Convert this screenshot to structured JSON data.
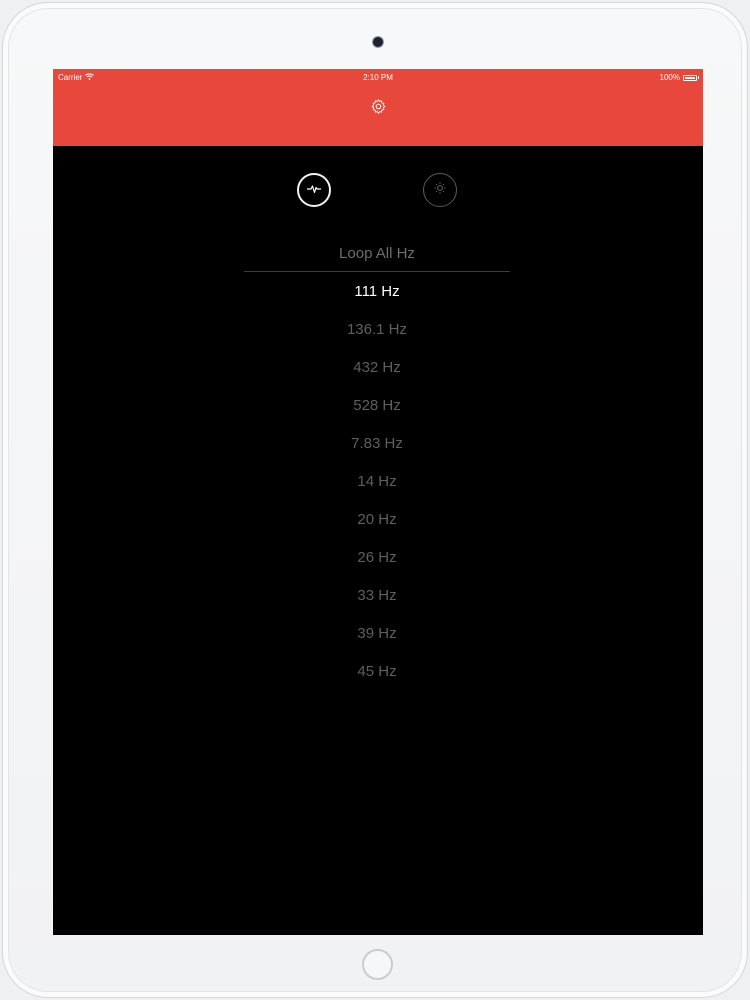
{
  "status_bar": {
    "carrier": "Carrier",
    "time": "2:10 PM",
    "battery": "100%"
  },
  "header": {
    "settings_icon": "gear-icon",
    "color": "#e8483b"
  },
  "modes": [
    {
      "icon": "pulse-wave-icon",
      "selected": true
    },
    {
      "icon": "sun-icon",
      "selected": false
    }
  ],
  "list": {
    "loop_all_label": "Loop All Hz",
    "items": [
      {
        "label": "111 Hz",
        "active": true
      },
      {
        "label": "136.1 Hz",
        "active": false
      },
      {
        "label": "432 Hz",
        "active": false
      },
      {
        "label": "528 Hz",
        "active": false
      },
      {
        "label": "7.83 Hz",
        "active": false
      },
      {
        "label": "14 Hz",
        "active": false
      },
      {
        "label": "20 Hz",
        "active": false
      },
      {
        "label": "26 Hz",
        "active": false
      },
      {
        "label": "33 Hz",
        "active": false
      },
      {
        "label": "39 Hz",
        "active": false
      },
      {
        "label": "45 Hz",
        "active": false
      }
    ]
  }
}
